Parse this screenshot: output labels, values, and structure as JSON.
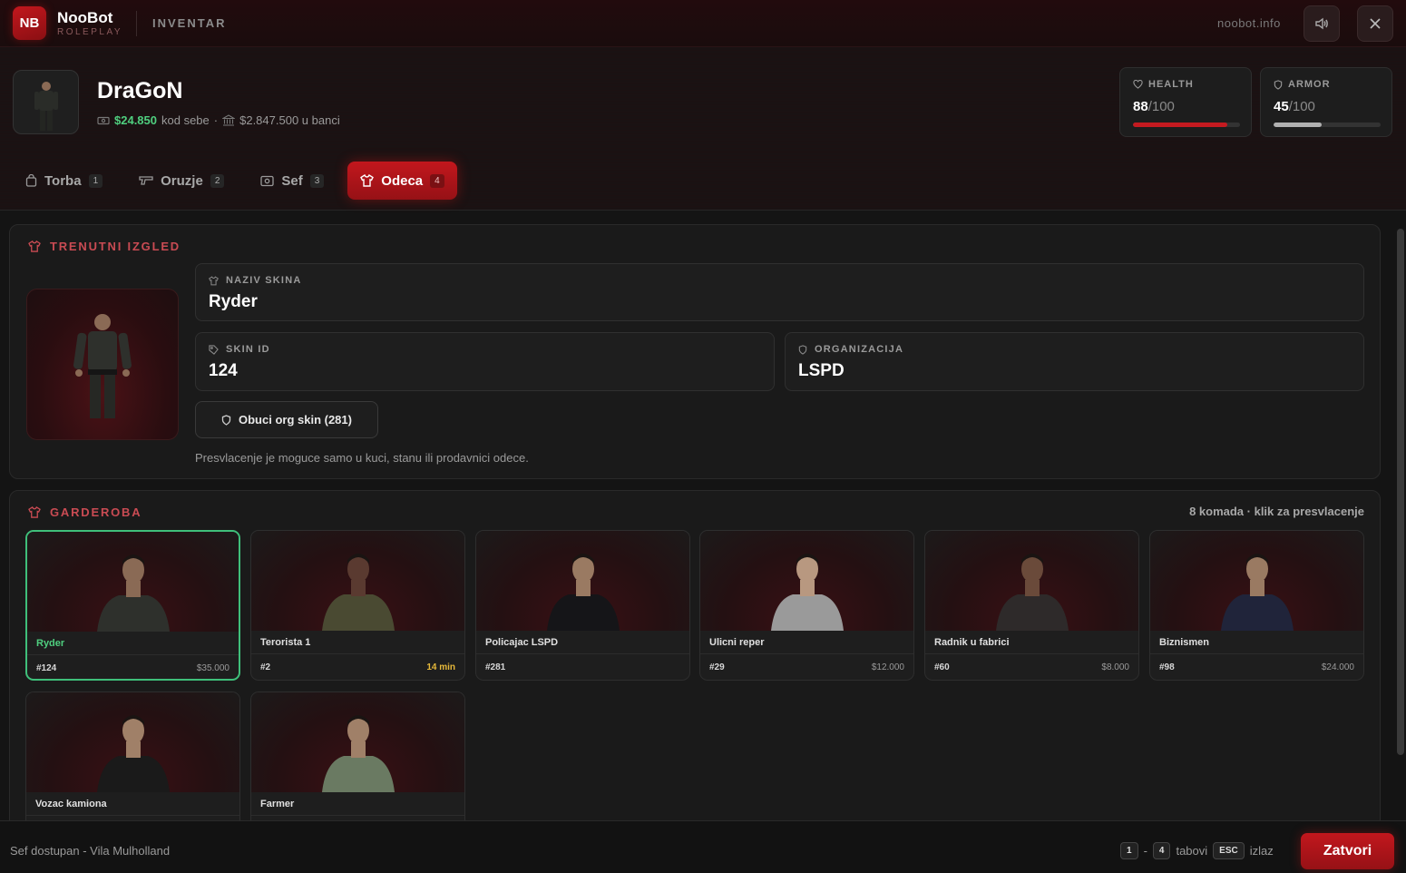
{
  "topbar": {
    "logo": "NB",
    "brand": "NooBot",
    "brand_sub": "ROLEPLAY",
    "module": "INVENTAR",
    "site": "noobot.info",
    "icons": [
      "speaker-icon",
      "close-icon"
    ]
  },
  "player": {
    "name": "DraGoN",
    "cash": "$24.850",
    "cash_label": "kod sebe",
    "separator": "·",
    "bank": "$2.847.500 u banci"
  },
  "stats": {
    "health": {
      "label": "HEALTH",
      "value": "88",
      "max": "/100",
      "fill": 0.88,
      "color": "#c41a20"
    },
    "armor": {
      "label": "ARMOR",
      "value": "45",
      "max": "/100",
      "fill": 0.45,
      "color": "#b0b0b0"
    }
  },
  "tabs": [
    {
      "label": "Torba",
      "count": "1",
      "icon": "bag-icon"
    },
    {
      "label": "Oruzje",
      "count": "2",
      "icon": "gun-icon"
    },
    {
      "label": "Sef",
      "count": "3",
      "icon": "safe-icon"
    },
    {
      "label": "Odeca",
      "count": "4",
      "icon": "shirt-icon",
      "active": true
    }
  ],
  "current_look": {
    "title": "TRENUTNI IZGLED",
    "skin_name_label": "NAZIV SKINA",
    "skin_name": "Ryder",
    "skin_id_label": "SKIN ID",
    "skin_id": "124",
    "org_label": "ORGANIZACIJA",
    "org": "LSPD",
    "org_button": "Obuci org skin (281)",
    "hint": "Presvlacenje je moguce samo u kuci, stanu ili prodavnici odece."
  },
  "wardrobe": {
    "title": "GARDEROBA",
    "meta": "8 komada · klik za presvlacenje",
    "skins": [
      {
        "name": "Ryder",
        "id": "#124",
        "price": "$35.000",
        "selected": true,
        "shirt": "#2e302c",
        "skin": "#8a6a55"
      },
      {
        "name": "Terorista 1",
        "id": "#2",
        "price": "14 min",
        "timer": true,
        "shirt": "#4a4a32",
        "skin": "#5a3a30"
      },
      {
        "name": "Policajac LSPD",
        "id": "#281",
        "price": "",
        "shirt": "#151518",
        "skin": "#9a7a62"
      },
      {
        "name": "Ulicni reper",
        "id": "#29",
        "price": "$12.000",
        "shirt": "#9a9a9a",
        "skin": "#b89880"
      },
      {
        "name": "Radnik u fabrici",
        "id": "#60",
        "price": "$8.000",
        "shirt": "#2e2a2a",
        "skin": "#6a4a3a"
      },
      {
        "name": "Biznismen",
        "id": "#98",
        "price": "$24.000",
        "shirt": "#20243a",
        "skin": "#9a7a62"
      },
      {
        "name": "Vozac kamiona",
        "id": "",
        "price": "",
        "shirt": "#1a1a1a",
        "skin": "#a08068"
      },
      {
        "name": "Farmer",
        "id": "",
        "price": "",
        "shirt": "#6a7a62",
        "skin": "#a08068"
      }
    ]
  },
  "footer": {
    "status": "Sef dostupan - Vila Mulholland",
    "key_from": "1",
    "key_dash": "-",
    "key_to": "4",
    "key_tabs": "tabovi",
    "key_esc": "ESC",
    "key_exit": "izlaz",
    "close": "Zatvori"
  }
}
